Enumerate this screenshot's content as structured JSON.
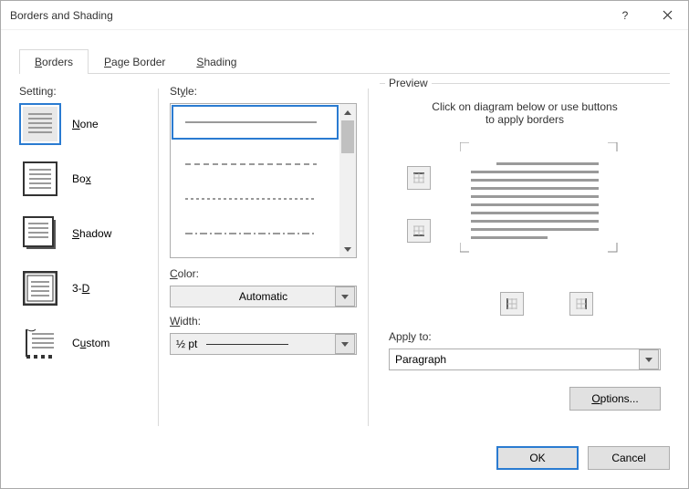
{
  "title": "Borders and Shading",
  "tabs": {
    "t0": "Borders",
    "t0u": "B",
    "t1": "Page Border",
    "t1u": "P",
    "t2": "Shading",
    "t2u": "S",
    "active": 0
  },
  "labels": {
    "setting": "Setting:",
    "style": "Style:",
    "color": "Color:",
    "width": "Width:",
    "preview": "Preview",
    "apply_to": "Apply to:",
    "hint1": "Click on diagram below or use buttons",
    "hint2": "to apply borders"
  },
  "settings": [
    {
      "label": "None",
      "u": "N",
      "icon": "none",
      "selected": true
    },
    {
      "label": "Box",
      "u": "x",
      "icon": "box"
    },
    {
      "label": "Shadow",
      "u": "S",
      "icon": "shadow"
    },
    {
      "label": "3-D",
      "u": "D",
      "icon": "3d"
    },
    {
      "label": "Custom",
      "u": "C",
      "icon": "custom"
    }
  ],
  "style": {
    "selected": 0,
    "options": [
      "solid",
      "long-dash",
      "short-dash",
      "dash-dot"
    ]
  },
  "color": {
    "value": "Automatic"
  },
  "width": {
    "value": "½ pt"
  },
  "apply": {
    "value": "Paragraph"
  },
  "buttons": {
    "options": "Options...",
    "ok": "OK",
    "cancel": "Cancel"
  }
}
